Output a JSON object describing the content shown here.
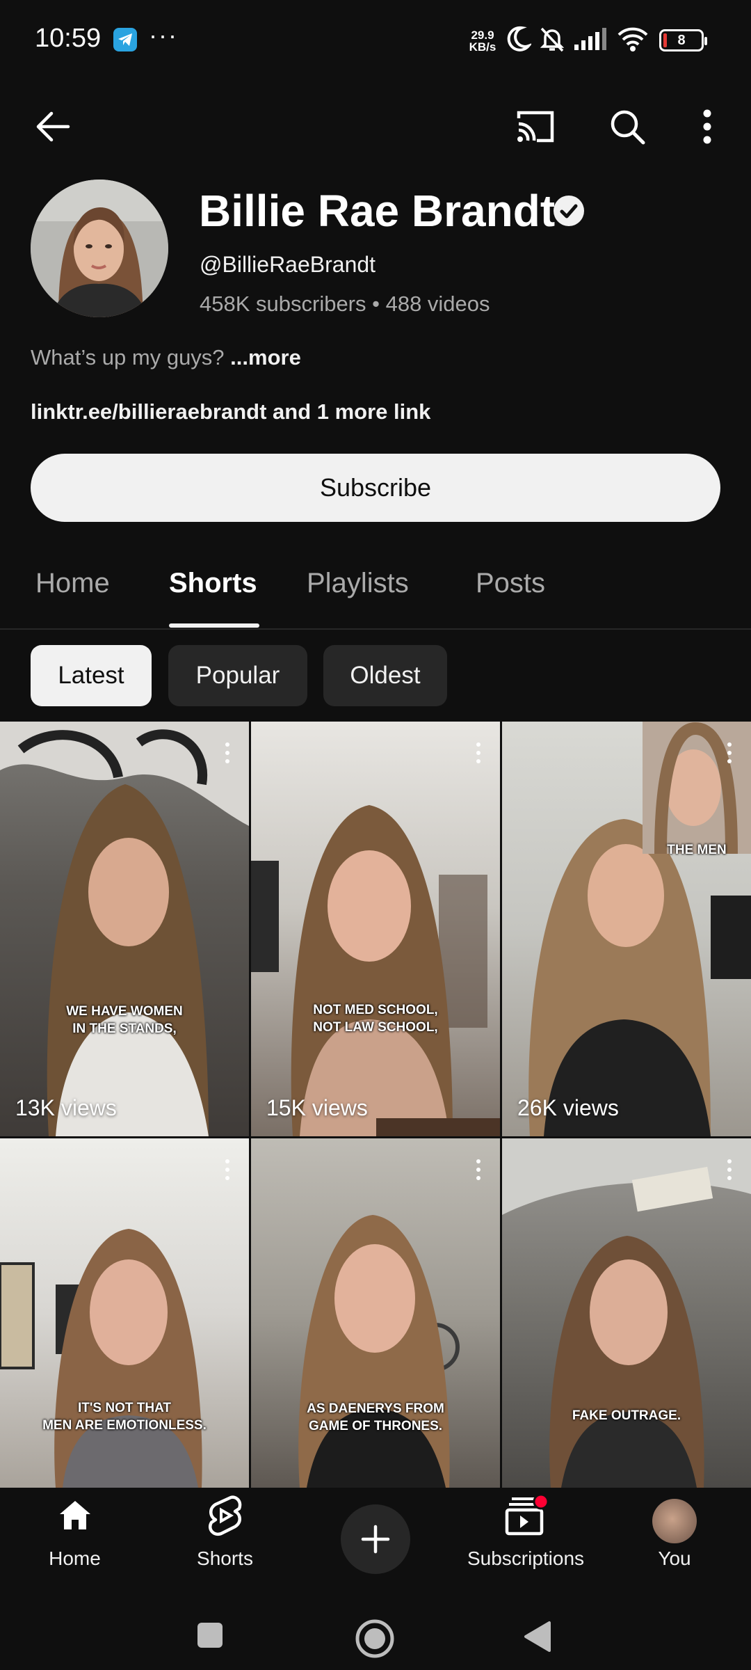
{
  "status_bar": {
    "time": "10:59",
    "more_dots": "···",
    "net_speed_value": "29.9",
    "net_speed_unit": "KB/s",
    "battery_level": "8",
    "icons": [
      "telegram-icon",
      "moon-icon",
      "bell-off-icon",
      "signal-icon",
      "wifi-icon",
      "battery-icon"
    ]
  },
  "top_bar": {
    "icons": [
      "back-arrow-icon",
      "cast-icon",
      "search-icon",
      "more-vert-icon"
    ]
  },
  "channel": {
    "name": "Billie Rae Brandt",
    "verified": true,
    "handle": "@BillieRaeBrandt",
    "stats": "458K subscribers • 488 videos",
    "description": "What’s up my guys? ",
    "description_more": "...more",
    "link_primary": "linktr.ee/billieraebrandt",
    "link_more": " and 1 more link",
    "subscribe_label": "Subscribe"
  },
  "tabs": [
    {
      "label": "Home",
      "active": false
    },
    {
      "label": "Shorts",
      "active": true
    },
    {
      "label": "Playlists",
      "active": false
    },
    {
      "label": "Posts",
      "active": false
    }
  ],
  "sort_chips": [
    {
      "label": "Latest",
      "selected": true
    },
    {
      "label": "Popular",
      "selected": false
    },
    {
      "label": "Oldest",
      "selected": false
    }
  ],
  "shorts": [
    {
      "caption_line1": "WE HAVE WOMEN",
      "caption_line2": "IN THE STANDS,",
      "views": "13K views"
    },
    {
      "caption_line1": "NOT MED SCHOOL,",
      "caption_line2": "NOT LAW SCHOOL,",
      "views": "15K views"
    },
    {
      "caption_line1": "THE MEN",
      "caption_line2": "",
      "views": "26K views"
    },
    {
      "caption_line1": "IT'S NOT THAT",
      "caption_line2": "MEN ARE EMOTIONLESS.",
      "views": ""
    },
    {
      "caption_line1": "AS DAENERYS FROM",
      "caption_line2": "GAME OF THRONES.",
      "views": ""
    },
    {
      "caption_line1": "FAKE OUTRAGE.",
      "caption_line2": "",
      "views": ""
    }
  ],
  "bottom_nav": [
    {
      "label": "Home",
      "icon": "home-icon"
    },
    {
      "label": "Shorts",
      "icon": "shorts-icon"
    },
    {
      "label": "",
      "icon": "create-plus-icon"
    },
    {
      "label": "Subscriptions",
      "icon": "subscriptions-icon"
    },
    {
      "label": "You",
      "icon": "you-avatar"
    }
  ],
  "system_nav": [
    "recents-square-icon",
    "home-circle-icon",
    "back-triangle-icon"
  ]
}
